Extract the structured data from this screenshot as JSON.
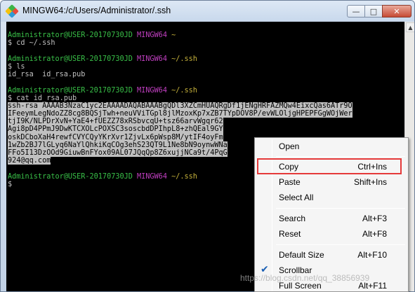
{
  "window": {
    "title": "MINGW64:/c/Users/Administrator/.ssh",
    "minimize_glyph": "—",
    "maximize_glyph": "□",
    "close_glyph": "✕"
  },
  "terminal": {
    "prompt_user": "Administrator@USER-20170730JD",
    "prompt_host": "MINGW64",
    "path_home": "~",
    "path_ssh": "~/.ssh",
    "cmd_cd": "$ cd ~/.ssh",
    "cmd_ls": "$ ls",
    "ls_output": "id_rsa  id_rsa.pub",
    "cmd_cat": "$ cat id_rsa.pub",
    "key_lines": [
      "ssh-rsa AAAAB3NzaC1yc2EAAAADAQABAAABgQDl3XZCmHUAQRgDf1jENgHRFAZMQw4EixcQas6ATr9O",
      "IFeeymLegNdoZZ8cg8BQSjTwh+neuVViTGpl8jlMzoxKp7xZB7TYpDOV8P/evWLOljgHPEPFGgWOjWer",
      "tjI9K/NLPDrXvN+YaE4+fUEZZ78xRSbvcqU+tsz66arvWgqr62",
      "Agi8pD4PPmJ9DwKTCXOLcPOXSC3soscbdDPIhpL8+zhQEal9GY",
      "oskDCboXaH4rewfCVYCQyYKrXvr1ZjvLx6pWsp8M/ytIF4oyFm",
      "1wZb2BJ7lGLyq6NaYlQhkiKqCOg3ehS23QT9L1Ne8bN9oynwWNa",
      "FFo5I13DzOOd9GiuwBnFYox09AL07JQqQp8Z6xujjNCa9t/4PqG",
      "924@qq.com"
    ],
    "prompt_final": "$"
  },
  "context_menu": {
    "items": [
      {
        "label": "Open",
        "shortcut": ""
      },
      {
        "label": "Copy",
        "shortcut": "Ctrl+Ins"
      },
      {
        "label": "Paste",
        "shortcut": "Shift+Ins"
      },
      {
        "label": "Select All",
        "shortcut": ""
      },
      {
        "label": "Search",
        "shortcut": "Alt+F3"
      },
      {
        "label": "Reset",
        "shortcut": "Alt+F8"
      },
      {
        "label": "Default Size",
        "shortcut": "Alt+F10"
      },
      {
        "label": "Scrollbar",
        "shortcut": "",
        "checked": true
      },
      {
        "label": "Full Screen",
        "shortcut": "Alt+F11"
      }
    ],
    "highlighted_item": "Copy",
    "check_glyph": "✔"
  },
  "scrollbar": {
    "up_arrow_glyph": "▲"
  },
  "watermark": "https://blog.csdn.net/qq_38856939",
  "colors": {
    "prompt_user": "#39c048",
    "prompt_host": "#c13fc1",
    "prompt_path": "#c6b23b",
    "highlight_box": "#e53a3a"
  }
}
